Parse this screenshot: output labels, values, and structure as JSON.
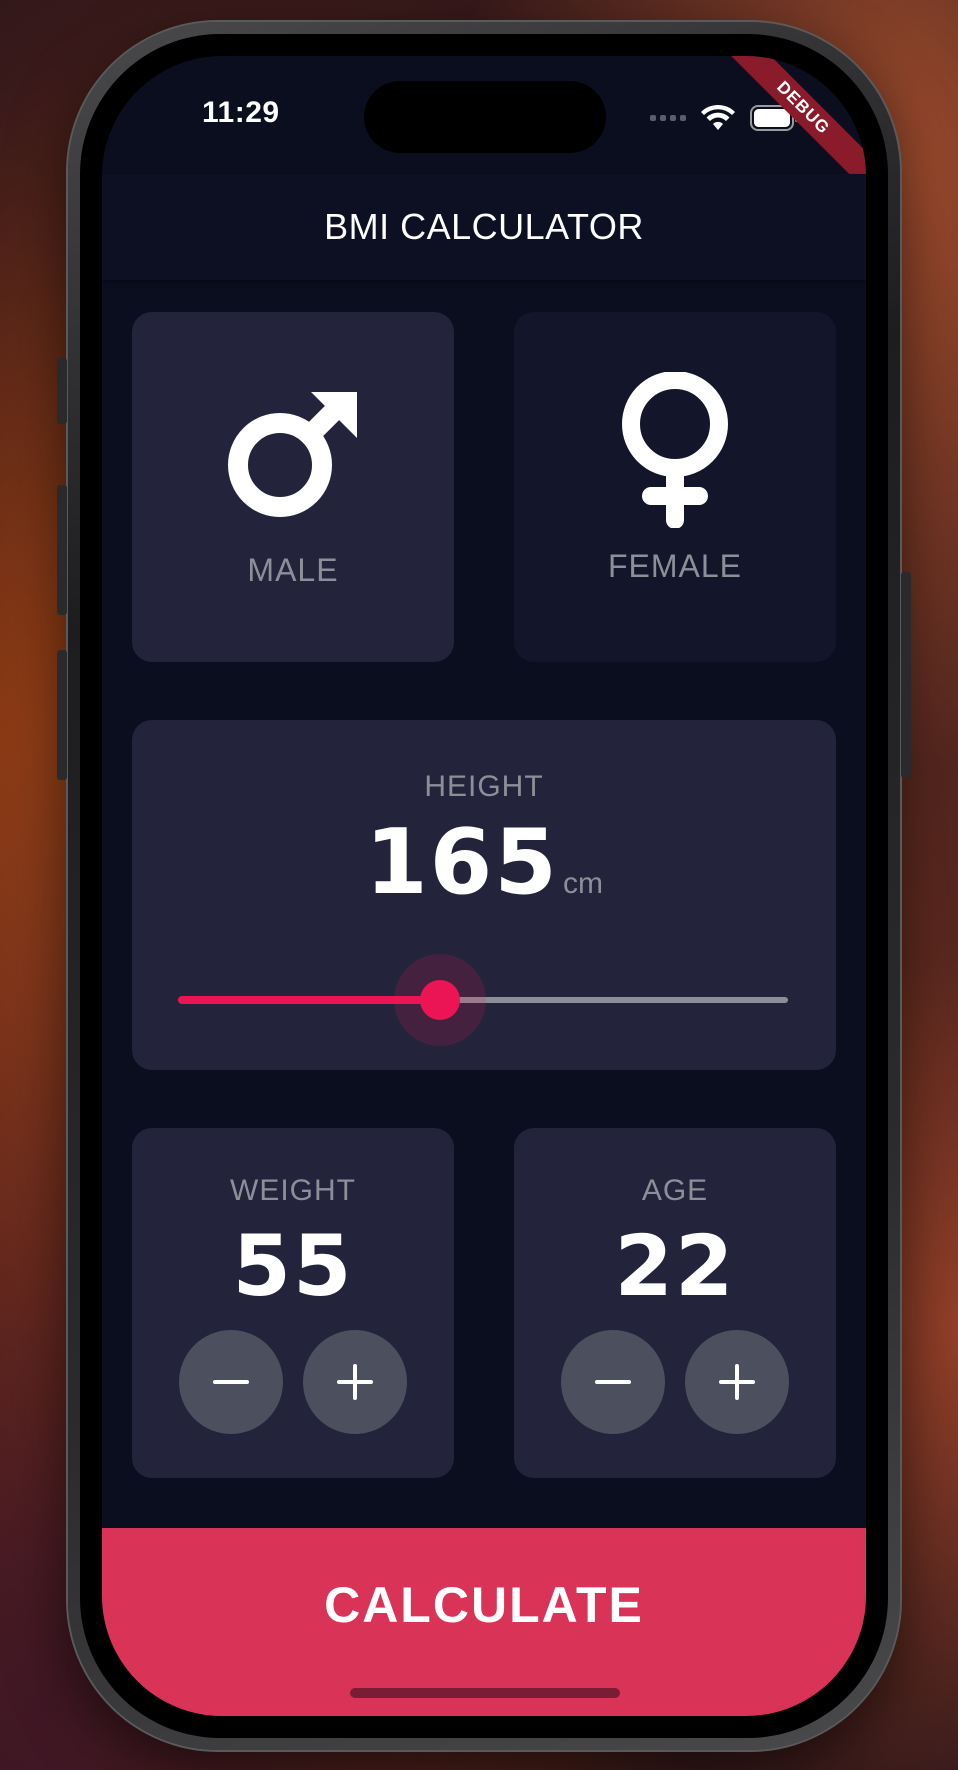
{
  "status_bar": {
    "time": "11:29"
  },
  "debug_banner": "DEBUG",
  "app_bar": {
    "title": "BMI CALCULATOR"
  },
  "gender": {
    "male": {
      "label": "MALE",
      "icon": "male-symbol-icon",
      "selected": true
    },
    "female": {
      "label": "FEMALE",
      "icon": "female-symbol-icon",
      "selected": false
    }
  },
  "height": {
    "label": "HEIGHT",
    "value": "165",
    "unit": "cm",
    "slider_fraction": 0.43
  },
  "weight": {
    "label": "WEIGHT",
    "value": "55",
    "minus": "−",
    "plus": "+"
  },
  "age": {
    "label": "AGE",
    "value": "22",
    "minus": "−",
    "plus": "+"
  },
  "calculate_label": "CALCULATE",
  "colors": {
    "accent": "#eb1555",
    "calc_button": "#da3358",
    "background": "#0b0e1f",
    "card_active": "#23243b",
    "card_inactive": "#13162a",
    "label_gray": "#8d8e98"
  }
}
